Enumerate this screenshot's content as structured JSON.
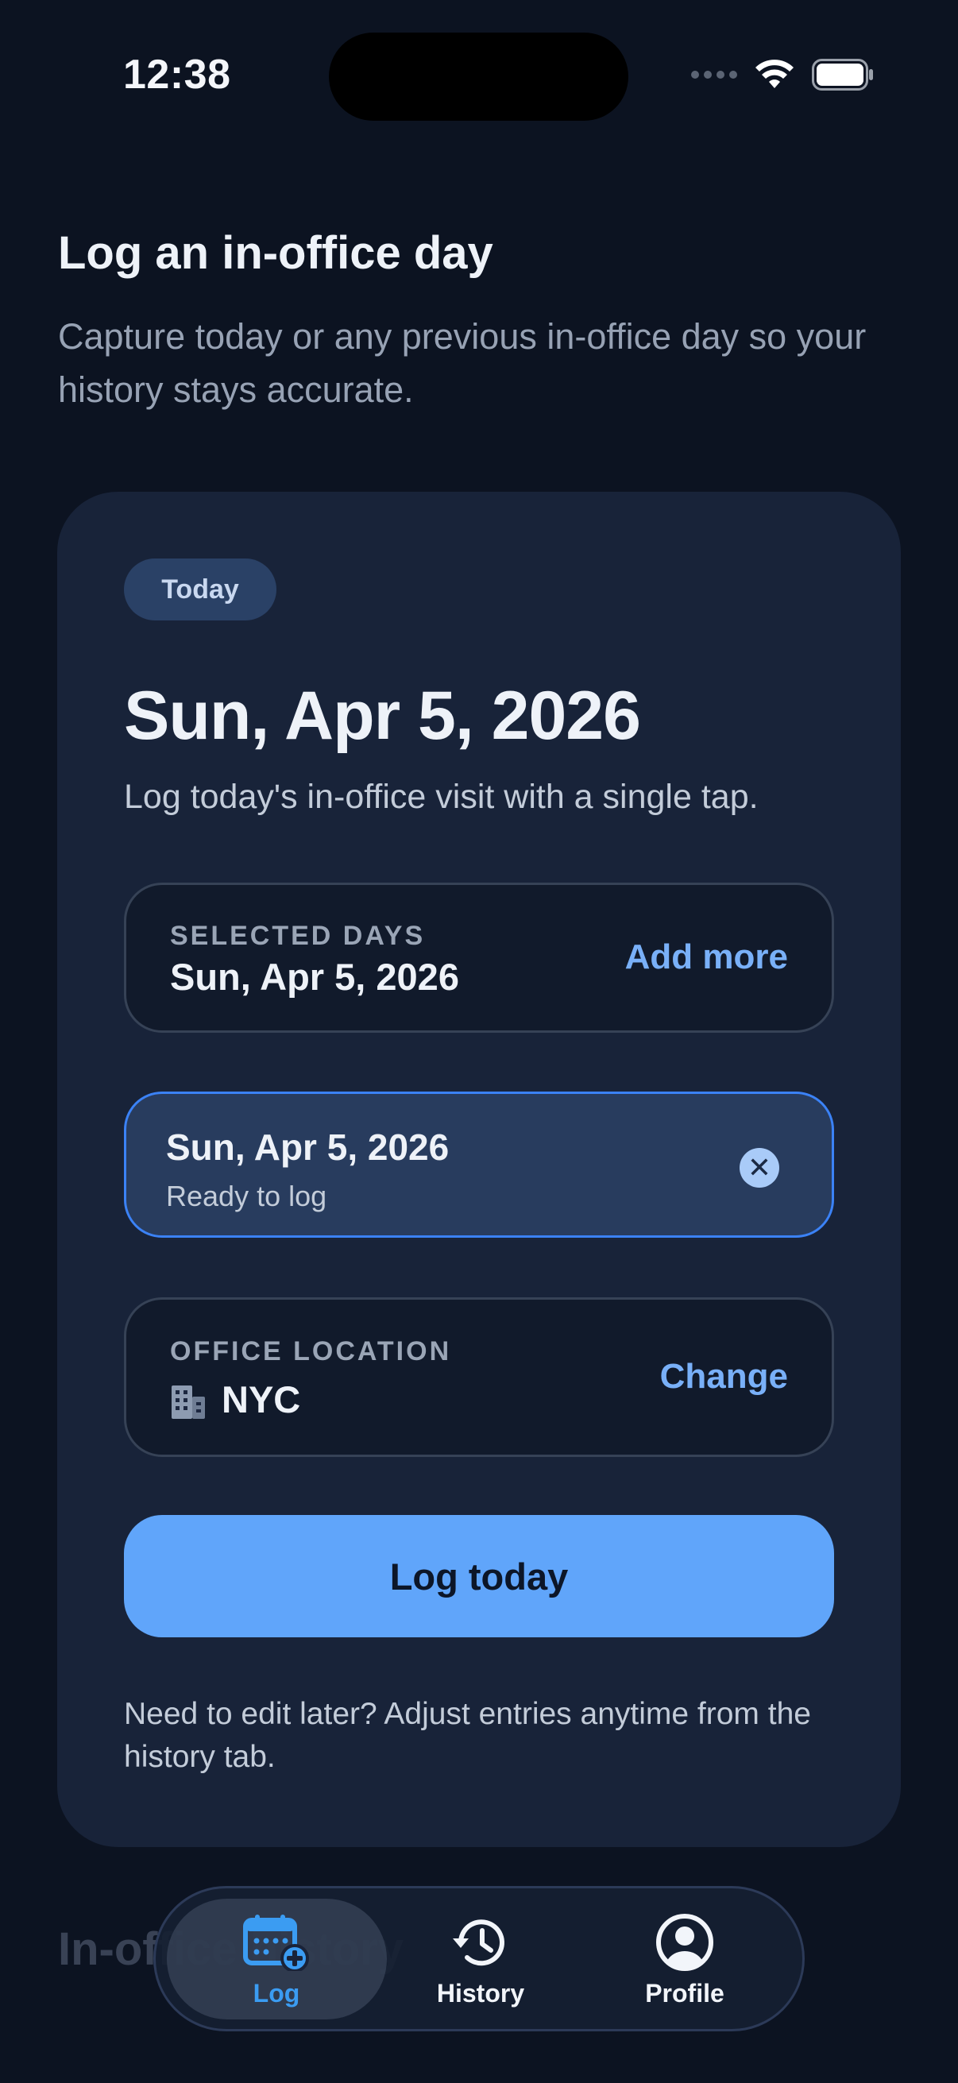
{
  "status_bar": {
    "time": "12:38"
  },
  "header": {
    "title": "Log an in-office day",
    "subtitle": "Capture today or any previous in-office day so your history stays accurate."
  },
  "card": {
    "pill": "Today",
    "date": "Sun, Apr 5, 2026",
    "description": "Log today's in-office visit with a single tap.",
    "selected_days": {
      "label": "SELECTED DAYS",
      "value": "Sun, Apr 5, 2026",
      "action": "Add more"
    },
    "chip": {
      "date": "Sun, Apr 5, 2026",
      "status": "Ready to log",
      "remove_glyph": "✕"
    },
    "office": {
      "label": "OFFICE LOCATION",
      "value": "NYC",
      "icon": "building-icon",
      "action": "Change"
    },
    "button": "Log today",
    "note": "Need to edit later? Adjust entries anytime from the history tab."
  },
  "behind_nav_heading": "In-office history",
  "tabbar": {
    "active": "log",
    "tabs": [
      {
        "id": "log",
        "label": "Log",
        "icon": "calendar-plus-icon"
      },
      {
        "id": "history",
        "label": "History",
        "icon": "history-icon"
      },
      {
        "id": "profile",
        "label": "Profile",
        "icon": "profile-icon"
      }
    ]
  },
  "colors": {
    "background": "#0c1321",
    "card": "#182339",
    "accent": "#60a5fa",
    "active_tab": "#3b9cf2"
  }
}
